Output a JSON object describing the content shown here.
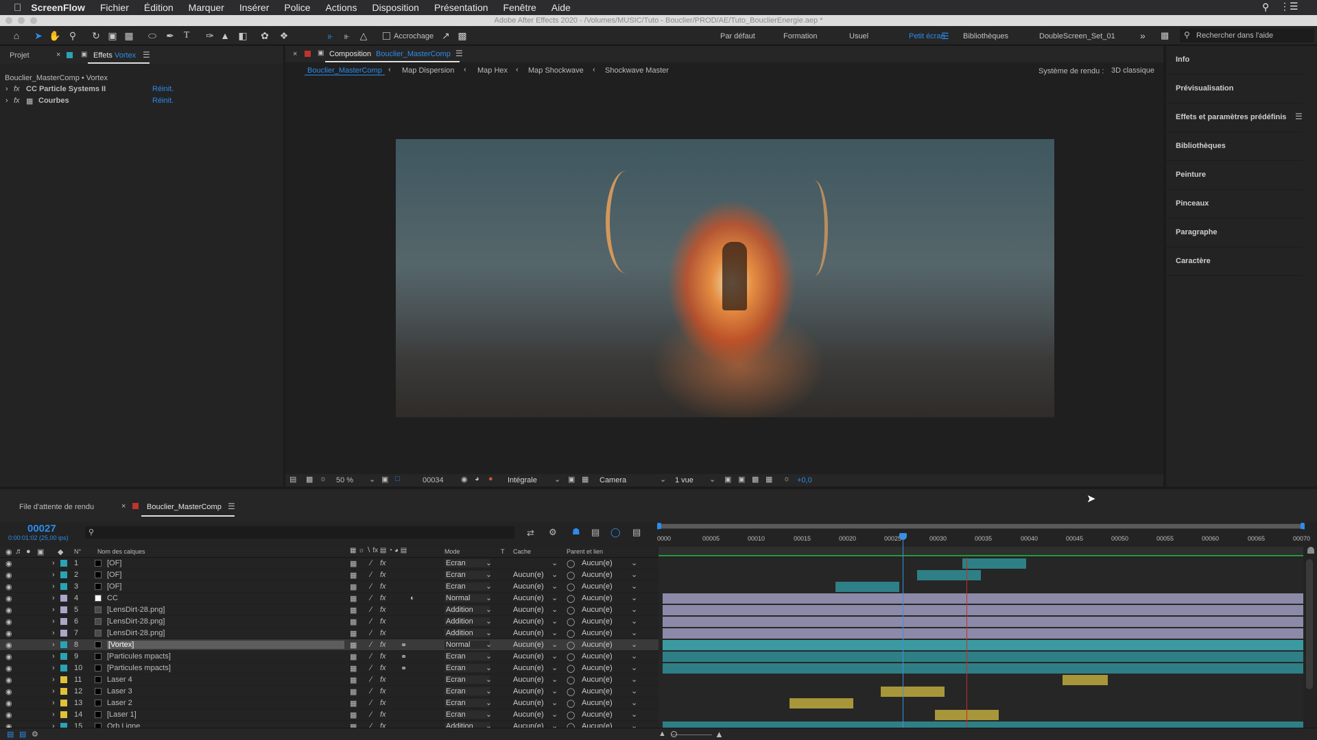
{
  "menubar": {
    "apple_icon": "apple-icon",
    "app": "ScreenFlow",
    "items": [
      "Fichier",
      "Édition",
      "Marquer",
      "Insérer",
      "Police",
      "Actions",
      "Disposition",
      "Présentation",
      "Fenêtre",
      "Aide"
    ]
  },
  "window_title": "Adobe After Effects 2020 - /Volumes/MUSIC/Tuto - Bouclier/PROD/AE/Tuto_BouclierEnergie.aep *",
  "toolbar": {
    "snap_label": "Accrochage",
    "workspaces": [
      "Par défaut",
      "Formation",
      "Usuel",
      "Petit écran",
      "Bibliothèques",
      "DoubleScreen_Set_01"
    ],
    "active_workspace": "Petit écran",
    "search_placeholder": "Rechercher dans l'aide"
  },
  "left_panel": {
    "tab_project": "Projet",
    "tab_effects": "Effets",
    "tab_effects_target": "Vortex",
    "breadcrumb": "Bouclier_MasterComp • Vortex",
    "effects": [
      {
        "name": "CC Particle Systems II",
        "reset": "Réinit."
      },
      {
        "name": "Courbes",
        "reset": "Réinit."
      }
    ]
  },
  "comp_panel": {
    "tab_label": "Composition",
    "tab_comp": "Bouclier_MasterComp",
    "flow": [
      "Bouclier_MasterComp",
      "Map Dispersion",
      "Map Hex",
      "Map Shockwave",
      "Shockwave Master"
    ],
    "renderer_label": "Système de rendu :",
    "renderer_value": "3D classique",
    "footer": {
      "zoom": "50 %",
      "timecode": "00034",
      "resolution": "Intégrale",
      "camera": "Camera",
      "views": "1 vue",
      "exposure": "+0,0"
    }
  },
  "right_panel": {
    "items": [
      "Info",
      "Prévisualisation",
      "Effets et paramètres prédéfinis",
      "Bibliothèques",
      "Peinture",
      "Pinceaux",
      "Paragraphe",
      "Caractère"
    ]
  },
  "timeline": {
    "tab_render": "File d'attente de rendu",
    "tab_comp": "Bouclier_MasterComp",
    "current_frame": "00027",
    "current_time": "0:00:01:02 (25,00 ips)",
    "col_num": "N°",
    "col_name": "Nom des calques",
    "col_mode": "Mode",
    "col_t": "T",
    "col_matte": "Cache",
    "col_parent": "Parent et lien",
    "ruler": [
      "0000",
      "00005",
      "00010",
      "00015",
      "00020",
      "00025",
      "00030",
      "00035",
      "00040",
      "00045",
      "00050",
      "00055",
      "00060",
      "00065",
      "00070"
    ],
    "layers": [
      {
        "n": "1",
        "name": "[OF]",
        "mode": "Ecran",
        "matte": "",
        "parent": "Aucun(e)"
      },
      {
        "n": "2",
        "name": "[OF]",
        "mode": "Ecran",
        "matte": "Aucun(e)",
        "parent": "Aucun(e)"
      },
      {
        "n": "3",
        "name": "[OF]",
        "mode": "Ecran",
        "matte": "Aucun(e)",
        "parent": "Aucun(e)"
      },
      {
        "n": "4",
        "name": "CC",
        "mode": "Normal",
        "matte": "Aucun(e)",
        "parent": "Aucun(e)"
      },
      {
        "n": "5",
        "name": "[LensDirt-28.png]",
        "mode": "Addition",
        "matte": "Aucun(e)",
        "parent": "Aucun(e)"
      },
      {
        "n": "6",
        "name": "[LensDirt-28.png]",
        "mode": "Addition",
        "matte": "Aucun(e)",
        "parent": "Aucun(e)"
      },
      {
        "n": "7",
        "name": "[LensDirt-28.png]",
        "mode": "Addition",
        "matte": "Aucun(e)",
        "parent": "Aucun(e)"
      },
      {
        "n": "8",
        "name": "[Vortex]",
        "mode": "Normal",
        "matte": "Aucun(e)",
        "parent": "Aucun(e)"
      },
      {
        "n": "9",
        "name": "[Particules mpacts]",
        "mode": "Ecran",
        "matte": "Aucun(e)",
        "parent": "Aucun(e)"
      },
      {
        "n": "10",
        "name": "[Particules mpacts]",
        "mode": "Ecran",
        "matte": "Aucun(e)",
        "parent": "Aucun(e)"
      },
      {
        "n": "11",
        "name": "Laser 4",
        "mode": "Ecran",
        "matte": "Aucun(e)",
        "parent": "Aucun(e)"
      },
      {
        "n": "12",
        "name": "Laser 3",
        "mode": "Ecran",
        "matte": "Aucun(e)",
        "parent": "Aucun(e)"
      },
      {
        "n": "13",
        "name": "Laser 2",
        "mode": "Ecran",
        "matte": "Aucun(e)",
        "parent": "Aucun(e)"
      },
      {
        "n": "14",
        "name": "[Laser 1]",
        "mode": "Ecran",
        "matte": "Aucun(e)",
        "parent": "Aucun(e)"
      },
      {
        "n": "15",
        "name": "Orb Ligne",
        "mode": "Addition",
        "matte": "Aucun(e)",
        "parent": "Aucun(e)"
      }
    ]
  },
  "colors": {
    "accent_blue": "#2d8ceb",
    "teal_bar": "#2f7f86",
    "lavender_bar": "#8c8aa8",
    "yellow_bar": "#a8963a",
    "selected_row": "#4a4a4a",
    "playhead": "#3b8fe6",
    "work_end": "#c42b2b"
  }
}
